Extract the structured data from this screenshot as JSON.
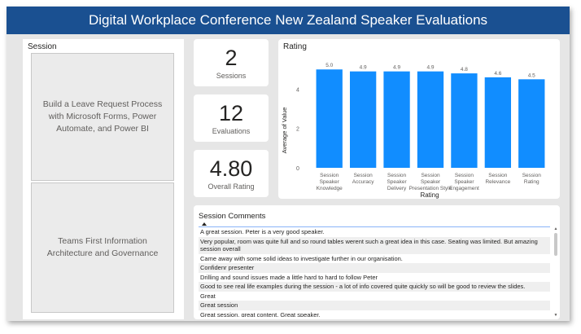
{
  "header": {
    "title": "Digital Workplace Conference New Zealand Speaker Evaluations"
  },
  "session_slicer": {
    "header": "Session",
    "items": [
      {
        "label": "Build a Leave Request Process with Microsoft Forms, Power Automate, and Power BI"
      },
      {
        "label": "Teams First Information Architecture and Governance"
      }
    ]
  },
  "kpis": [
    {
      "value": "2",
      "label": "Sessions"
    },
    {
      "value": "12",
      "label": "Evaluations"
    },
    {
      "value": "4.80",
      "label": "Overall Rating"
    }
  ],
  "chart_data": {
    "type": "bar",
    "title": "Rating",
    "xlabel": "Rating",
    "ylabel": "Average of Value",
    "categories": [
      "Session Speaker Knowledge",
      "Session Accuracy",
      "Session Speaker Delivery",
      "Session Speaker Presentation Style",
      "Session Speaker Engagement",
      "Session Relevance",
      "Session Rating"
    ],
    "values": [
      5.0,
      4.9,
      4.9,
      4.9,
      4.8,
      4.6,
      4.5
    ],
    "data_labels": [
      "5.0",
      "4.9",
      "4.9",
      "4.9",
      "4.8",
      "4.6",
      "4.5"
    ],
    "yticks": [
      "0",
      "2",
      "4"
    ],
    "ylim": [
      0,
      5.3
    ],
    "grid": false,
    "bar_color": "#118dff"
  },
  "comments": {
    "title": "Session Comments",
    "rows": [
      "A great session. Peter is a very good speaker.",
      "Very popular, room was quite full and so round tables werent such a great idea in this case. Seating was limited. But amazing session overall",
      "Came away with some solid ideas to investigate further in our organisation.",
      "Confidenr presenter",
      "Drilling and sound issues made a little hard to hard to follow Peter",
      "Good to see real life examples during the session - a lot of info covered quite quickly so will be good to review the slides.",
      "Great",
      "Great session",
      "Great session, great content. Great speaker."
    ]
  },
  "colors": {
    "title_bar": "#1a5091",
    "bar": "#118dff",
    "canvas": "#e6e6e6"
  }
}
